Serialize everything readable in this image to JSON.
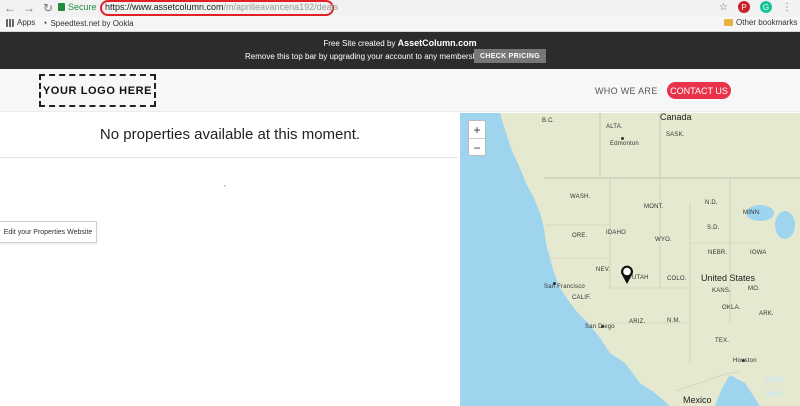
{
  "browser": {
    "secure_label": "Secure",
    "url_main": "https://www.assetcolumn.com",
    "url_path": "/m/aprilleavancena192/deals",
    "bookmarks": {
      "apps": "Apps",
      "speedtest": "Speedtest.net by Ookla",
      "other": "Other bookmarks"
    }
  },
  "promo": {
    "line1_prefix": "Free Site created by ",
    "line1_brand": "AssetColumn.com",
    "line2": "Remove this top bar by upgrading your account to any membership.",
    "check_pricing": "CHECK PRICING"
  },
  "header": {
    "logo_text": "YOUR LOGO HERE",
    "nav_who": "WHO WE ARE",
    "nav_contact": "CONTACT US"
  },
  "content": {
    "no_properties": "No properties available at this moment.",
    "stray_mark": ",",
    "edit_button": "Edit your Properties Website"
  },
  "map": {
    "zoom_in": "+",
    "zoom_out": "−",
    "labels": {
      "canada": "Canada",
      "bc": "B.C.",
      "alta": "ALTA.",
      "sask": "SASK.",
      "edmonton": "Edmonton",
      "wash": "WASH.",
      "mont": "MONT.",
      "nd": "N.D.",
      "minn": "MINN.",
      "ore": "ORE.",
      "idaho": "IDAHO",
      "wyo": "WYO.",
      "sd": "S.D.",
      "nebr": "NEBR.",
      "iowa": "IOWA",
      "nev": "NEV.",
      "utah": "UTAH",
      "colo": "COLO.",
      "united_states": "United States",
      "san_francisco": "San Francisco",
      "calif": "CALIF.",
      "kans": "KANS.",
      "mo": "MO.",
      "ariz": "ARIZ.",
      "nm": "N.M.",
      "okla": "OKLA.",
      "ark": "ARK.",
      "san_diego": "San Diego",
      "tex": "TEX.",
      "houston": "Houston",
      "mexico": "Mexico",
      "gulf": "Gulf",
      "mex": "Mex"
    }
  }
}
